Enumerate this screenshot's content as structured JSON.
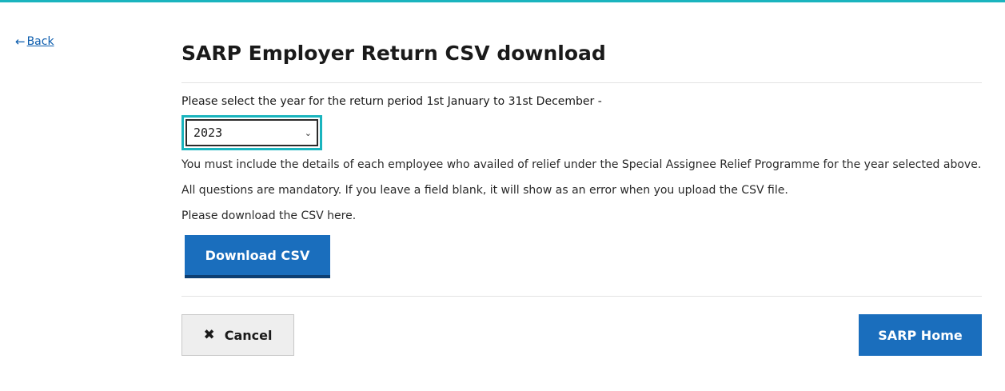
{
  "nav": {
    "back_arrow": "←",
    "back_label": "Back"
  },
  "page": {
    "title": "SARP Employer Return CSV download"
  },
  "year_select": {
    "label": "Please select the year for the return period 1st January to 31st December -",
    "selected": "2023",
    "icon": "chevron-down-icon"
  },
  "body": {
    "para1": "You must include the details of each employee who availed of relief under the Special Assignee Relief Programme for the year selected above.",
    "para2": "All questions are mandatory. If you leave a field blank, it will show as an error when you upload the CSV file.",
    "para3": "Please download the CSV here."
  },
  "actions": {
    "download_label": "Download CSV",
    "cancel_icon": "✖",
    "cancel_label": "Cancel",
    "home_label": "SARP Home"
  },
  "colors": {
    "accent": "#1ab4be",
    "primary_button": "#1a6ebd",
    "link": "#0b5cad"
  }
}
